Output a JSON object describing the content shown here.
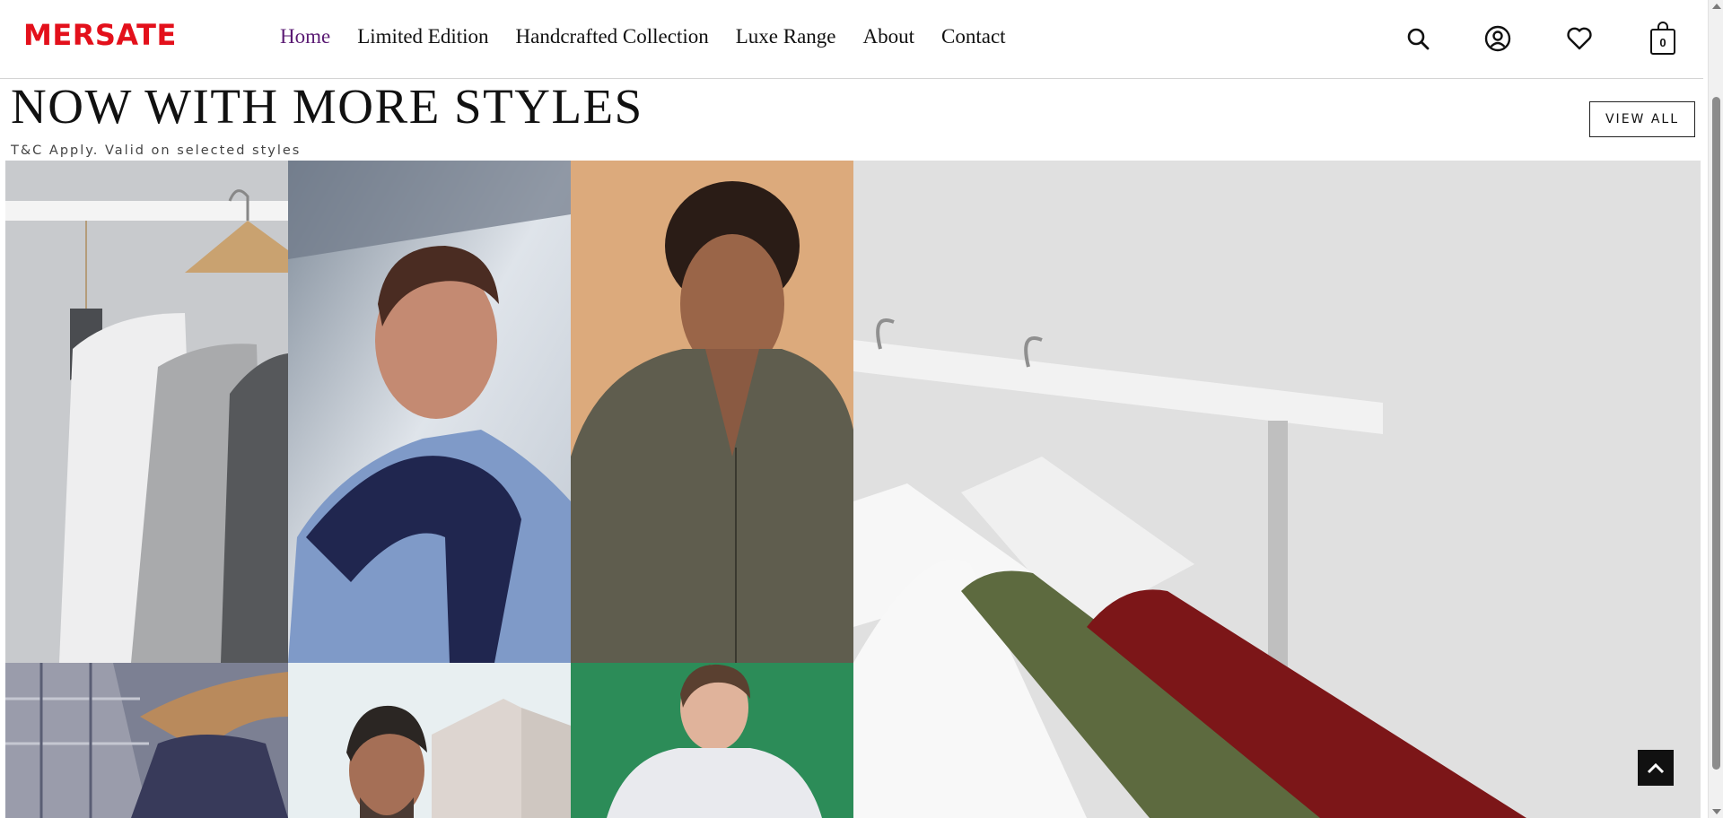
{
  "brand": {
    "logo_text": "MERSATE",
    "logo_color": "#e3101b"
  },
  "nav": {
    "items": [
      {
        "label": "Home",
        "active": true
      },
      {
        "label": "Limited Edition",
        "active": false
      },
      {
        "label": "Handcrafted Collection",
        "active": false
      },
      {
        "label": "Luxe Range",
        "active": false
      },
      {
        "label": "About",
        "active": false
      },
      {
        "label": "Contact",
        "active": false
      }
    ],
    "active_color": "#5a1a73"
  },
  "header_icons": {
    "search": "search-icon",
    "account": "user-circle-icon",
    "wishlist": "heart-icon",
    "cart": "shopping-bag-icon",
    "cart_count": "0"
  },
  "section": {
    "title": "NOW WITH MORE STYLES",
    "subtitle": "T&C Apply. Valid on selected styles",
    "view_all_label": "VIEW ALL"
  },
  "gallery": {
    "tiles": [
      {
        "name": "shirts-on-rack-grey"
      },
      {
        "name": "man-with-navy-sweater"
      },
      {
        "name": "man-in-olive-shirt"
      },
      {
        "name": "shirts-on-white-hangers"
      },
      {
        "name": "plaid-shirts-on-hangers"
      },
      {
        "name": "man-by-building"
      },
      {
        "name": "man-in-white-henley"
      }
    ]
  },
  "scroll_top_icon": "chevron-up-icon"
}
